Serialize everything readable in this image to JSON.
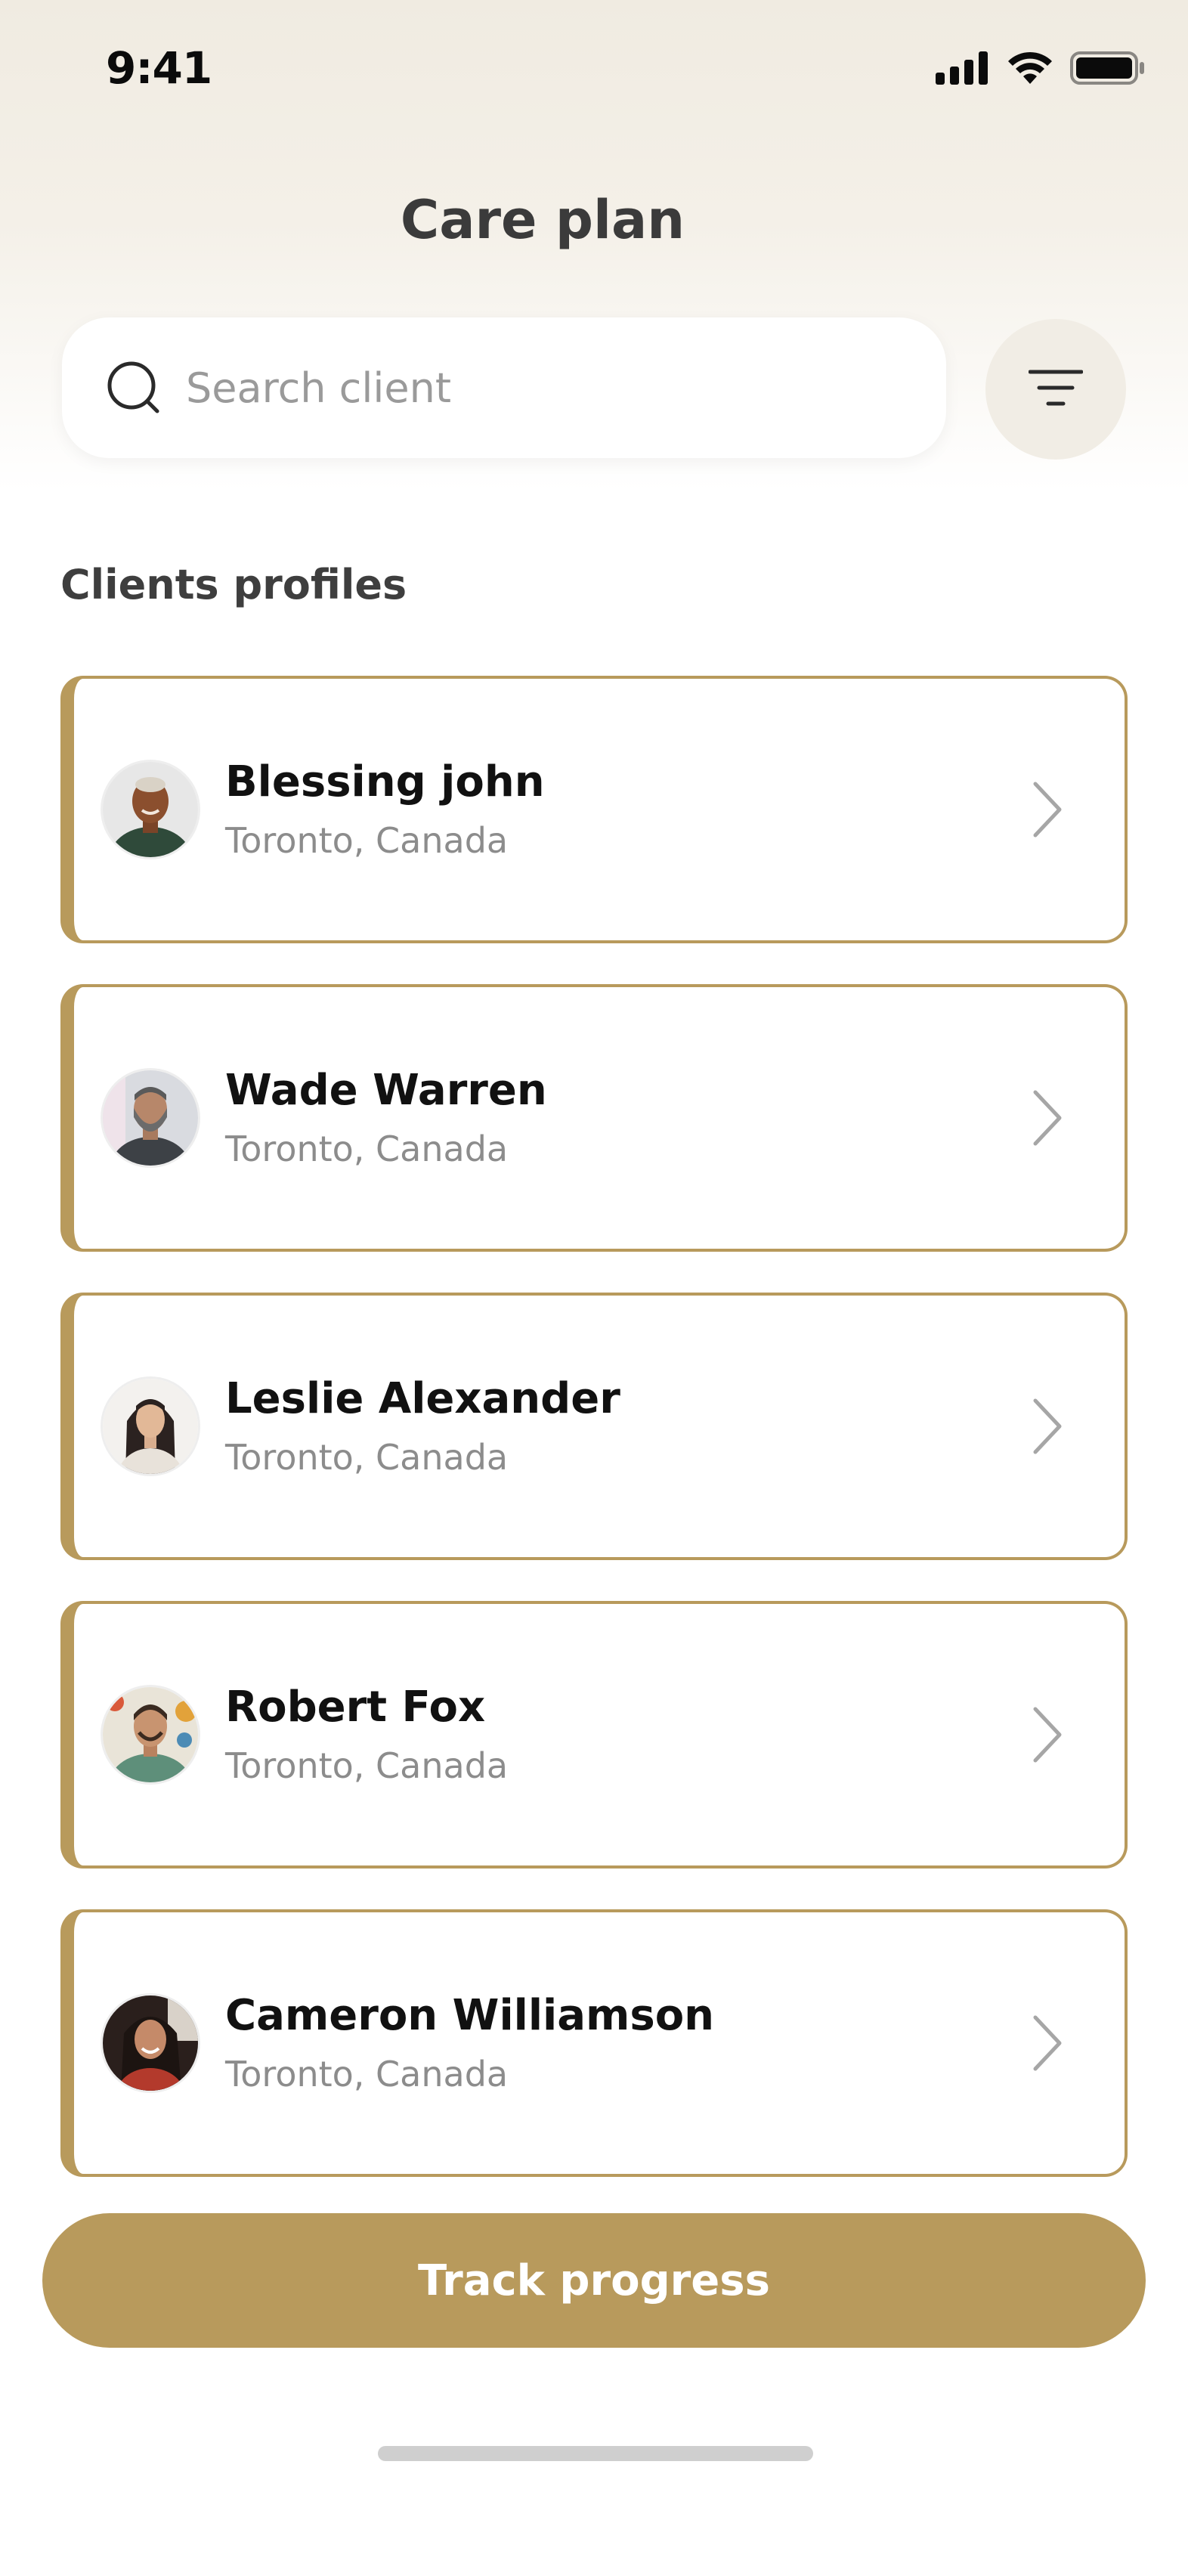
{
  "status_bar": {
    "time": "9:41",
    "icons": [
      "cellular-signal-icon",
      "wifi-icon",
      "battery-icon"
    ]
  },
  "header": {
    "title": "Care plan"
  },
  "search": {
    "placeholder": "Search client",
    "value": "",
    "icon": "search-icon",
    "filter_icon": "filter-icon"
  },
  "section": {
    "title": "Clients profiles"
  },
  "clients": [
    {
      "name": "Blessing john",
      "location": "Toronto, Canada"
    },
    {
      "name": "Wade Warren",
      "location": "Toronto, Canada"
    },
    {
      "name": "Leslie Alexander",
      "location": "Toronto, Canada"
    },
    {
      "name": "Robert Fox",
      "location": "Toronto, Canada"
    },
    {
      "name": "Cameron Williamson",
      "location": "Toronto, Canada"
    }
  ],
  "actions": {
    "track_progress": "Track progress"
  },
  "colors": {
    "accent": "#b89a5c",
    "header_bg": "#f0ebe1",
    "filter_bg": "#f1ede5",
    "muted_text": "#8c8c8c"
  }
}
